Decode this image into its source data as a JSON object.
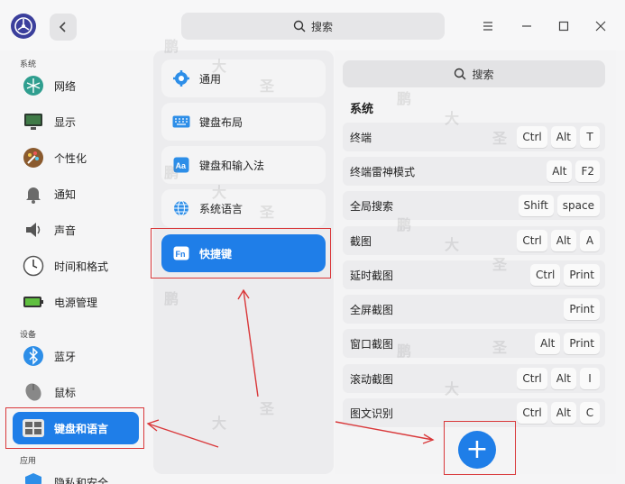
{
  "titlebar": {
    "search_label": "搜索"
  },
  "sidebar": {
    "section_system": "系统",
    "section_devices": "设备",
    "section_apps": "应用",
    "items": [
      {
        "label": "网络",
        "icon": "network-icon"
      },
      {
        "label": "显示",
        "icon": "display-icon"
      },
      {
        "label": "个性化",
        "icon": "personalization-icon"
      },
      {
        "label": "通知",
        "icon": "bell-icon"
      },
      {
        "label": "声音",
        "icon": "speaker-icon"
      },
      {
        "label": "时间和格式",
        "icon": "clock-icon"
      },
      {
        "label": "电源管理",
        "icon": "battery-icon"
      },
      {
        "label": "蓝牙",
        "icon": "bluetooth-icon"
      },
      {
        "label": "鼠标",
        "icon": "mouse-icon"
      },
      {
        "label": "键盘和语言",
        "icon": "keyboard-icon"
      },
      {
        "label": "隐私和安全",
        "icon": "shield-icon"
      }
    ]
  },
  "middle": {
    "items": [
      {
        "label": "通用",
        "icon": "gear-icon"
      },
      {
        "label": "键盘布局",
        "icon": "keyboard-layout-icon"
      },
      {
        "label": "键盘和输入法",
        "icon": "input-method-icon"
      },
      {
        "label": "系统语言",
        "icon": "globe-icon"
      },
      {
        "label": "快捷键",
        "icon": "fn-icon"
      }
    ]
  },
  "right": {
    "search_label": "搜索",
    "group_title": "系统",
    "shortcuts": [
      {
        "label": "终端",
        "keys": [
          "Ctrl",
          "Alt",
          "T"
        ]
      },
      {
        "label": "终端雷神模式",
        "keys": [
          "Alt",
          "F2"
        ]
      },
      {
        "label": "全局搜索",
        "keys": [
          "Shift",
          "space"
        ]
      },
      {
        "label": "截图",
        "keys": [
          "Ctrl",
          "Alt",
          "A"
        ]
      },
      {
        "label": "延时截图",
        "keys": [
          "Ctrl",
          "Print"
        ]
      },
      {
        "label": "全屏截图",
        "keys": [
          "Print"
        ]
      },
      {
        "label": "窗口截图",
        "keys": [
          "Alt",
          "Print"
        ]
      },
      {
        "label": "滚动截图",
        "keys": [
          "Ctrl",
          "Alt",
          "I"
        ]
      },
      {
        "label": "图文识别",
        "keys": [
          "Ctrl",
          "Alt",
          "C"
        ]
      }
    ],
    "add_label": "+"
  },
  "watermark_text": [
    "鹏",
    "大",
    "圣"
  ],
  "colors": {
    "accent": "#1f7ee8",
    "annotation": "#d9383a"
  }
}
